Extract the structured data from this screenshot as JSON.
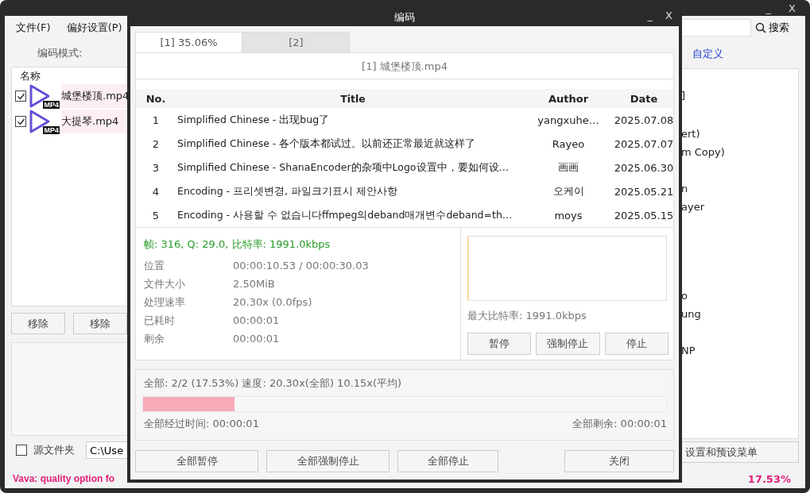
{
  "main_window": {
    "window_controls": [
      "_",
      "X"
    ],
    "menu": [
      {
        "label": "文件(F)"
      },
      {
        "label": "偏好设置(P)"
      }
    ],
    "encode_mode_label": "编码模式:",
    "file_list": {
      "header": "名称",
      "files": [
        {
          "name": "城堡楼顶.mp4",
          "checked": true,
          "badge": "MP4"
        },
        {
          "name": "大提琴.mp4",
          "checked": true,
          "badge": "MP4"
        }
      ]
    },
    "remove_buttons": [
      "移除",
      "移除"
    ],
    "source_folder": {
      "label": "源文件夹",
      "checked": false,
      "path": "C:\\Use"
    },
    "search_button": "搜索",
    "custom_link": "自定义",
    "option_fragments": [
      "]",
      "ert)",
      "m Copy)",
      "n",
      "ayer",
      "o",
      "ung",
      "NP"
    ],
    "settings_button": "设置和预设菜单",
    "notice": "Vava: quality option fo",
    "percent": "17.53%"
  },
  "dialog": {
    "title": "编码",
    "window_controls": [
      "_",
      "X"
    ],
    "tabs": [
      {
        "label": "[1] 35.06%",
        "selected": true
      },
      {
        "label": "[2]",
        "selected": false
      }
    ],
    "file_title": "[1] 城堡楼顶.mp4",
    "table": {
      "columns": [
        "No.",
        "Title",
        "Author",
        "Date"
      ],
      "rows": [
        [
          "1",
          "Simplified  Chinese  - 出现bug了",
          "yangxuhe…",
          "2025.07.08"
        ],
        [
          "2",
          "Simplified  Chinese  - 各个版本都试过。以前还正常最近就这样了",
          "Rayeo",
          "2025.07.07"
        ],
        [
          "3",
          "Simplified  Chinese  -  ShanaEncoder的杂项中Logo设置中，要如何设…",
          "画画",
          "2025.06.30"
        ],
        [
          "4",
          "Encoding  - 프리셋변경, 파일크기표시 제안사항",
          "오케이",
          "2025.05.21"
        ],
        [
          "5",
          "Encoding  - 사용할 수 없습니다ffmpeg의deband매개변수deband=th…",
          "moys",
          "2025.05.15"
        ]
      ]
    },
    "status_line": "帧: 316, Q: 29.0, 比特率: 1991.0kbps",
    "info": [
      {
        "label": "位置",
        "value": "00:00:10.53 / 00:00:30.03"
      },
      {
        "label": "文件大小",
        "value": "2.50MiB"
      },
      {
        "label": "处理速率",
        "value": "20.30x (0.0fps)"
      },
      {
        "label": "已耗时",
        "value": "00:00:01"
      },
      {
        "label": "剩余",
        "value": "00:00:01"
      }
    ],
    "max_bitrate": "最大比特率: 1991.0kbps",
    "task_buttons": [
      "暂停",
      "强制停止",
      "停止"
    ],
    "overall": {
      "summary": "全部: 2/2 (17.53%) 速度: 20.30x(全部) 10.15x(平均)",
      "level": 0.1753,
      "elapsed": "全部经过时间: 00:00:01",
      "remaining": "全部剩余: 00:00:01"
    },
    "buttons": [
      "全部暂停",
      "全部强制停止",
      "全部停止"
    ],
    "close_button": "关闭"
  }
}
